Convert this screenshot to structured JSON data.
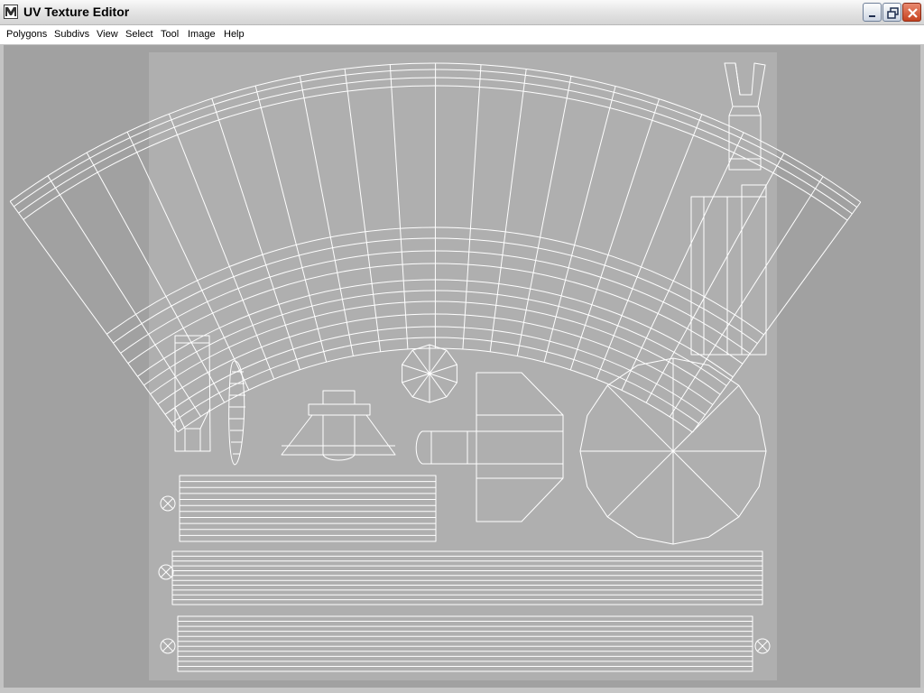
{
  "window": {
    "title": "UV Texture Editor",
    "controls": [
      "minimize",
      "restore",
      "close"
    ]
  },
  "menu": {
    "items": [
      "Polygons",
      "Subdivs",
      "View",
      "Select",
      "Tool",
      "Image",
      "Help"
    ]
  },
  "colors": {
    "viewport_background": "#a1a1a1",
    "texture_square": "#afafaf",
    "uv_wire": "#ffffff",
    "title_bar": "#e6e6e6",
    "close_button": "#c6421f"
  },
  "icons": {
    "app": "maya-icon",
    "minimize": "minimize-icon",
    "restore": "restore-icon",
    "close": "close-icon"
  }
}
